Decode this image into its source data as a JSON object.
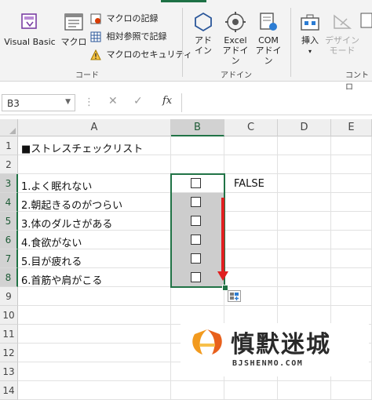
{
  "ribbon": {
    "code_group": {
      "visual_basic_label": "Visual Basic",
      "macro_label": "マクロ",
      "record_macro_label": "マクロの記録",
      "relative_ref_label": "相対参照で記録",
      "macro_security_label": "マクロのセキュリティ",
      "group_label": "コード"
    },
    "addins_group": {
      "addins_line1": "アド",
      "addins_line2": "イン",
      "excel_addins_line1": "Excel",
      "excel_addins_line2": "アドイン",
      "com_addins_line1": "COM",
      "com_addins_line2": "アドイン",
      "group_label": "アドイン"
    },
    "controls_group": {
      "insert_label": "挿入",
      "design_mode_line1": "デザイン",
      "design_mode_line2": "モード",
      "group_label": "コントロ"
    }
  },
  "formula_bar": {
    "name_box": "B3",
    "fx": "fx",
    "cancel_glyph": "✕",
    "enter_glyph": "✓",
    "formula": ""
  },
  "sheet": {
    "columns": [
      "A",
      "B",
      "C",
      "D",
      "E"
    ],
    "rows": [
      "1",
      "2",
      "3",
      "4",
      "5",
      "6",
      "7",
      "8",
      "9",
      "10",
      "11",
      "12",
      "13",
      "14"
    ],
    "cells": {
      "A1": "■ストレスチェックリスト",
      "A3": "1.よく眠れない",
      "A4": "2.朝起きるのがつらい",
      "A5": "3.体のダルさがある",
      "A6": "4.食欲がない",
      "A7": "5.目が疲れる",
      "A8": "6.首筋や肩がこる",
      "C3": "FALSE"
    },
    "checkbox_rows": [
      "3",
      "4",
      "5",
      "6",
      "7",
      "8"
    ]
  },
  "watermark": {
    "brand": "慎默迷城",
    "url": "BJSHENMO.COM"
  },
  "colors": {
    "excel_green": "#217346",
    "arrow_red": "#e02020",
    "selection_shade": "#cdcdcd"
  }
}
